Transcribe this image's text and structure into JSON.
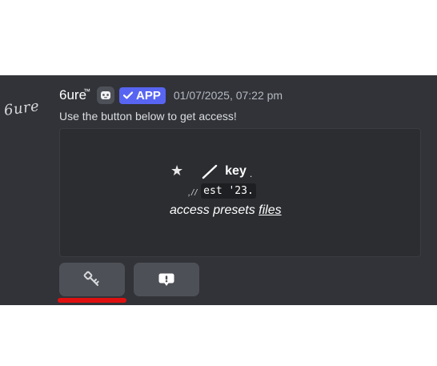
{
  "message": {
    "avatar_text": "6ure",
    "username": "6ure",
    "trademark": "™",
    "badge_label": "APP",
    "timestamp": "01/07/2025, 07:22 pm",
    "content": "Use the button below to get access!"
  },
  "embed": {
    "star": "★",
    "key_label": "key",
    "key_suffix": ".",
    "slashes": ",//",
    "est_code": "est '23.",
    "access_text": "access presets ",
    "files_link": "files"
  },
  "buttons": [
    {
      "icon": "key-icon"
    },
    {
      "icon": "alert-icon"
    }
  ],
  "colors": {
    "panel_bg": "#313338",
    "embed_bg": "#2b2d31",
    "badge_bg": "#5865f2",
    "button_bg": "#4e5058",
    "highlight_red": "#e01010"
  }
}
